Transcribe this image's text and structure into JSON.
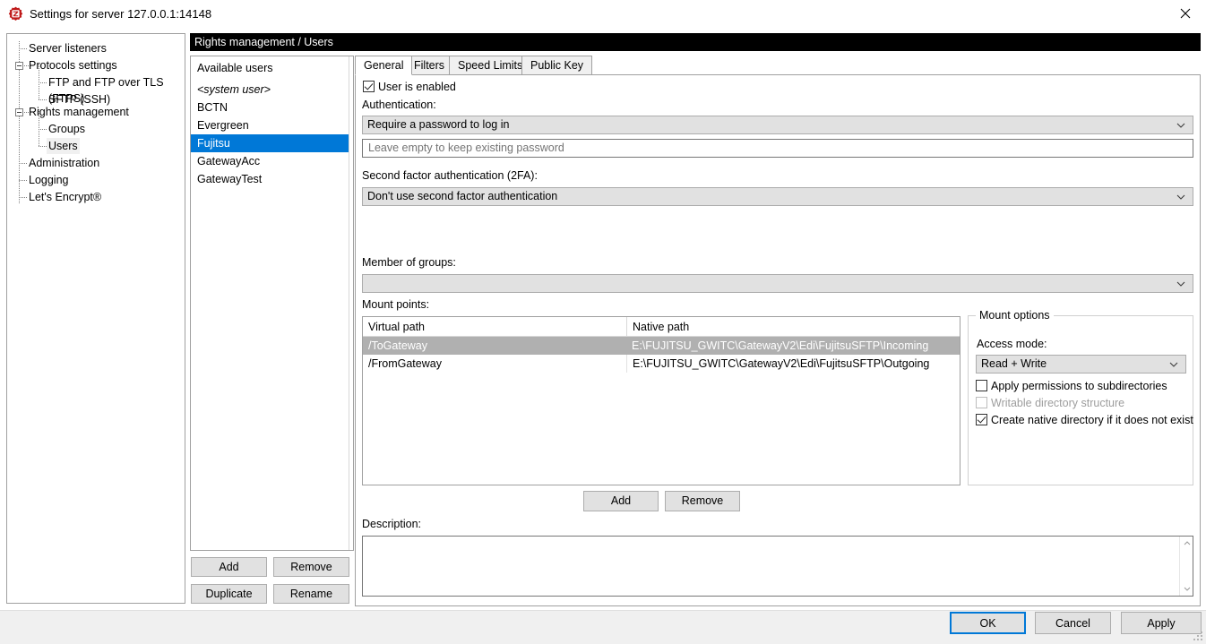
{
  "window": {
    "title": "Settings for server 127.0.0.1:14148",
    "icon": "filezilla-server-icon",
    "close_label": "close-icon"
  },
  "colors": {
    "selection_blue": "#0078d7",
    "header_black": "#000000",
    "row_selected_gray": "#b0b0b0",
    "control_gray": "#e1e1e1",
    "disabled_text": "#9d9d9d"
  },
  "tree": {
    "items": [
      {
        "label": "Server listeners",
        "level": 1,
        "expander": false,
        "selected": false
      },
      {
        "label": "Protocols settings",
        "level": 0,
        "expander": true,
        "selected": false
      },
      {
        "label": "FTP and FTP over TLS (FTPS)",
        "level": 2,
        "expander": false,
        "selected": false
      },
      {
        "label": "SFTP (SSH)",
        "level": 2,
        "expander": false,
        "selected": false
      },
      {
        "label": "Rights management",
        "level": 0,
        "expander": true,
        "selected": false
      },
      {
        "label": "Groups",
        "level": 2,
        "expander": false,
        "selected": false
      },
      {
        "label": "Users",
        "level": 2,
        "expander": false,
        "selected": true
      },
      {
        "label": "Administration",
        "level": 1,
        "expander": false,
        "selected": false
      },
      {
        "label": "Logging",
        "level": 1,
        "expander": false,
        "selected": false
      },
      {
        "label": "Let's Encrypt®",
        "level": 1,
        "expander": false,
        "selected": false
      }
    ]
  },
  "header": {
    "breadcrumb": "Rights management / Users"
  },
  "users": {
    "title": "Available users",
    "items": [
      {
        "name": "<system user>",
        "italic": true,
        "selected": false
      },
      {
        "name": "BCTN",
        "italic": false,
        "selected": false
      },
      {
        "name": "Evergreen",
        "italic": false,
        "selected": false
      },
      {
        "name": "Fujitsu",
        "italic": false,
        "selected": true
      },
      {
        "name": "GatewayAcc",
        "italic": false,
        "selected": false
      },
      {
        "name": "GatewayTest",
        "italic": false,
        "selected": false
      }
    ],
    "buttons": {
      "add": "Add",
      "remove": "Remove",
      "duplicate": "Duplicate",
      "rename": "Rename"
    }
  },
  "tabs": [
    {
      "label": "General",
      "active": true
    },
    {
      "label": "Filters",
      "active": false
    },
    {
      "label": "Speed Limits",
      "active": false
    },
    {
      "label": "Public Key",
      "active": false
    }
  ],
  "general": {
    "user_enabled": {
      "label": "User is enabled",
      "checked": true
    },
    "authentication_label": "Authentication:",
    "authentication_value": "Require a password to log in",
    "password_placeholder": "Leave empty to keep existing password",
    "password_value": "",
    "second_factor_label": "Second factor authentication (2FA):",
    "second_factor_value": "Don't use second factor authentication",
    "member_of_groups_label": "Member of groups:",
    "member_of_groups_value": "",
    "mount_points_label": "Mount points:",
    "mount_points": {
      "columns": [
        "Virtual path",
        "Native path"
      ],
      "rows": [
        {
          "virtual_path": "/ToGateway",
          "native_path": "E:\\FUJITSU_GWITC\\GatewayV2\\Edi\\FujitsuSFTP\\Incoming",
          "selected": true
        },
        {
          "virtual_path": "/FromGateway",
          "native_path": "E:\\FUJITSU_GWITC\\GatewayV2\\Edi\\FujitsuSFTP\\Outgoing",
          "selected": false
        }
      ]
    },
    "mount_buttons": {
      "add": "Add",
      "remove": "Remove"
    },
    "description_label": "Description:",
    "description_value": ""
  },
  "mount_options": {
    "group_title": "Mount options",
    "access_mode_label": "Access mode:",
    "access_mode_value": "Read + Write",
    "checkboxes": [
      {
        "label": "Apply permissions to subdirectories",
        "checked": false,
        "disabled": false
      },
      {
        "label": "Writable directory structure",
        "checked": false,
        "disabled": true
      },
      {
        "label": "Create native directory if it does not exist",
        "checked": true,
        "disabled": false
      }
    ]
  },
  "footer": {
    "ok": "OK",
    "cancel": "Cancel",
    "apply": "Apply"
  }
}
